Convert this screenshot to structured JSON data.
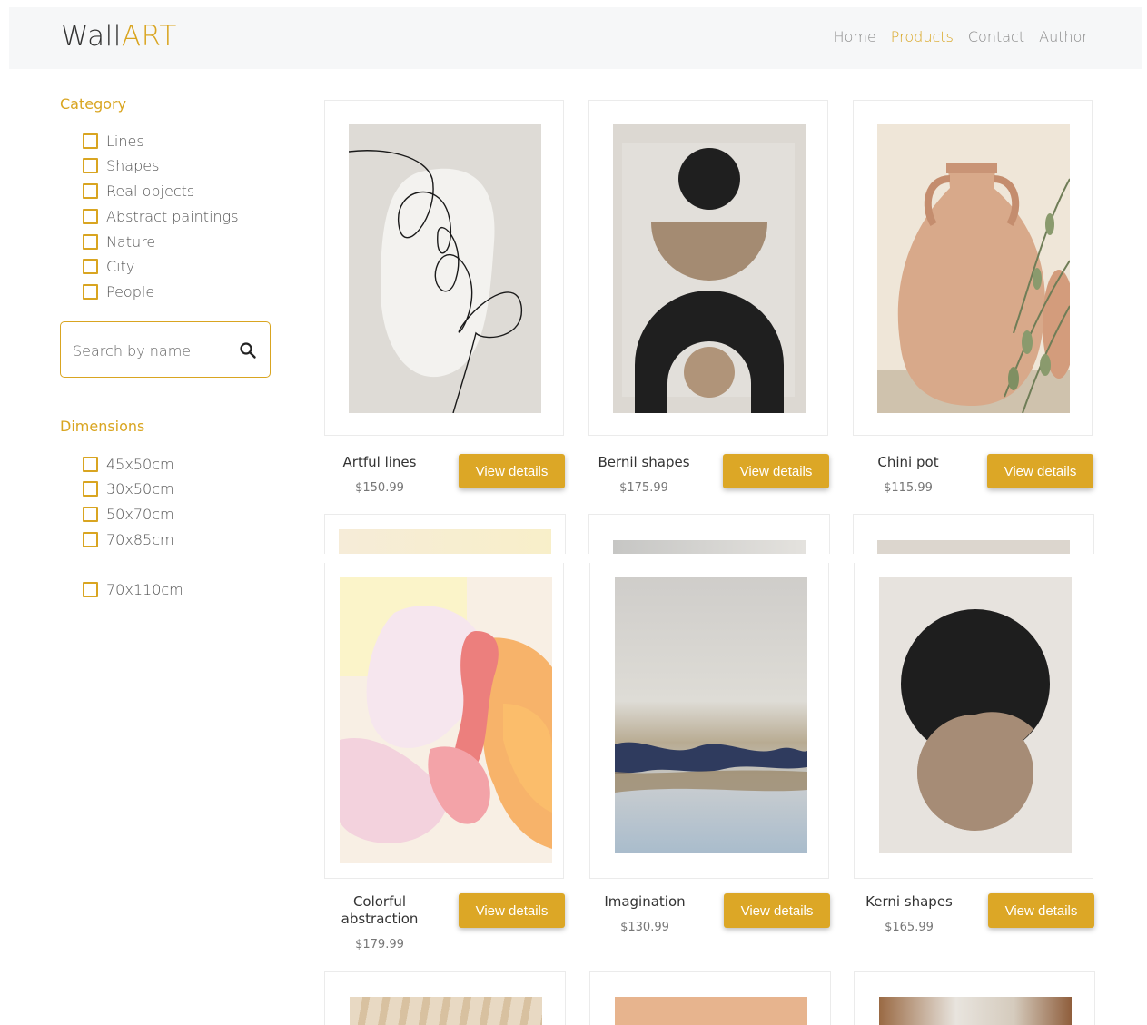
{
  "header": {
    "logo_part1": "Wall",
    "logo_part2": "ART",
    "nav": [
      "Home",
      "Products",
      "Contact",
      "Author"
    ],
    "active_nav": "Products"
  },
  "sidebar": {
    "category_title": "Category",
    "categories": [
      "Lines",
      "Shapes",
      "Real objects",
      "Abstract paintings",
      "Nature",
      "City",
      "People"
    ],
    "search_placeholder": "Search by name",
    "dimensions_title": "Dimensions",
    "dimensions": [
      "45x50cm",
      "30x50cm",
      "50x70cm",
      "70x85cm",
      "70x110cm"
    ]
  },
  "products": [
    {
      "name": "Artful lines",
      "price": "$150.99",
      "button": "View details"
    },
    {
      "name": "Bernil shapes",
      "price": "$175.99",
      "button": "View details"
    },
    {
      "name": "Chini pot",
      "price": "$115.99",
      "button": "View details"
    },
    {
      "name": "Colorful abstraction",
      "price": "$179.99",
      "button": "View details"
    },
    {
      "name": "Imagination",
      "price": "$130.99",
      "button": "View details"
    },
    {
      "name": "Kerni shapes",
      "price": "$165.99",
      "button": "View details"
    }
  ],
  "colors": {
    "accent": "#d9a521",
    "button": "#dca726",
    "header_bg": "#f6f7f8"
  },
  "icons": {
    "search": "search-icon"
  }
}
